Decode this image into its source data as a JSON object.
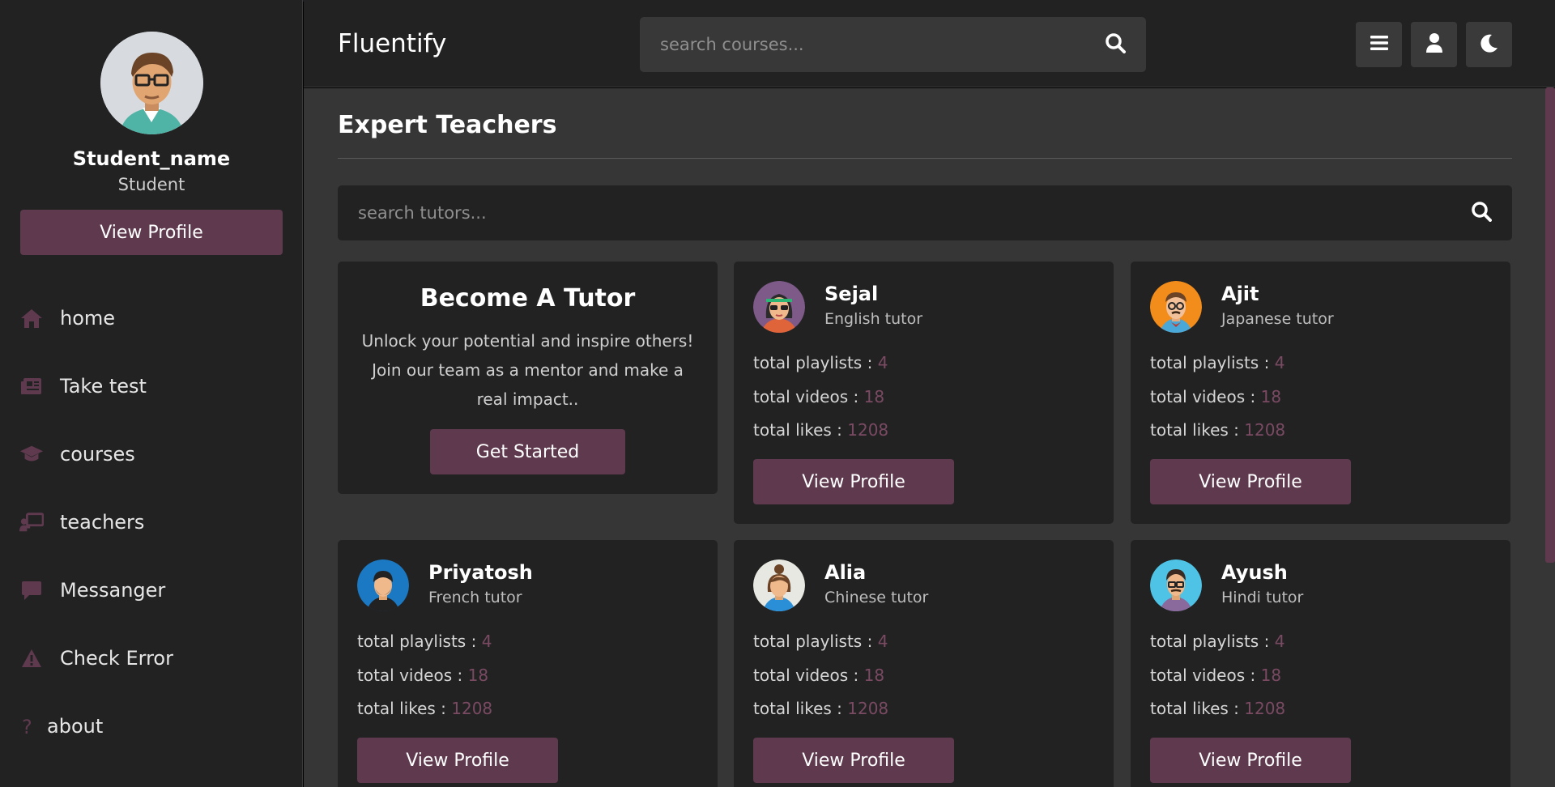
{
  "app": {
    "name": "Fluentify",
    "accent": "#5f3a4f",
    "stat_value_color": "#7a4a63"
  },
  "header": {
    "search_placeholder": "search courses...",
    "icons": [
      "search-icon",
      "menu-icon",
      "user-icon",
      "moon-icon"
    ]
  },
  "sidebar": {
    "user_name": "Student_name",
    "user_role": "Student",
    "view_profile": "View Profile",
    "items": [
      {
        "label": "home",
        "icon": "home-icon"
      },
      {
        "label": "Take test",
        "icon": "newspaper-icon"
      },
      {
        "label": "courses",
        "icon": "graduation-cap-icon"
      },
      {
        "label": "teachers",
        "icon": "teacher-icon"
      },
      {
        "label": "Messanger",
        "icon": "message-icon"
      },
      {
        "label": "Check Error",
        "icon": "warning-icon"
      },
      {
        "label": "about",
        "icon": "question-icon"
      }
    ]
  },
  "main": {
    "title": "Expert Teachers",
    "tutor_search_placeholder": "search tutors...",
    "become": {
      "title": "Become A Tutor",
      "text": "Unlock your potential and inspire others! Join our team as a mentor and make a real impact..",
      "button": "Get Started"
    },
    "stat_labels": {
      "playlists": "total playlists : ",
      "videos": "total videos : ",
      "likes": "total likes : "
    },
    "view_profile": "View Profile",
    "tutors": [
      {
        "name": "Sejal",
        "subject": "English tutor",
        "playlists": "4",
        "videos": "18",
        "likes": "1208"
      },
      {
        "name": "Ajit",
        "subject": "Japanese tutor",
        "playlists": "4",
        "videos": "18",
        "likes": "1208"
      },
      {
        "name": "Priyatosh",
        "subject": "French tutor",
        "playlists": "4",
        "videos": "18",
        "likes": "1208"
      },
      {
        "name": "Alia",
        "subject": "Chinese tutor",
        "playlists": "4",
        "videos": "18",
        "likes": "1208"
      },
      {
        "name": "Ayush",
        "subject": "Hindi tutor",
        "playlists": "4",
        "videos": "18",
        "likes": "1208"
      }
    ]
  }
}
